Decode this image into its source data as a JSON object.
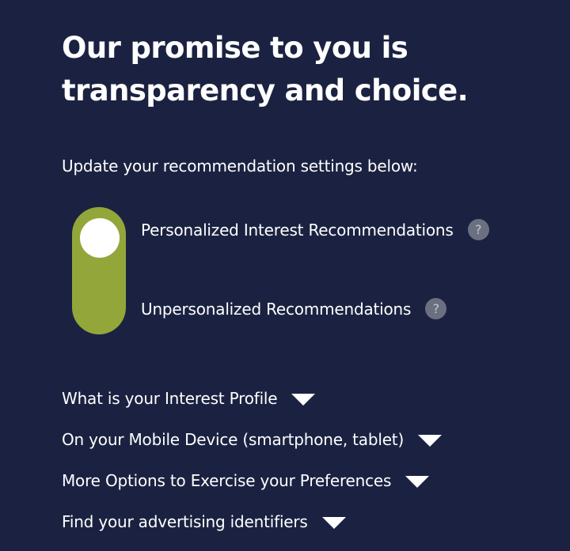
{
  "headline": "Our promise to you is transparency and choice.",
  "intro": "Update your recommendation settings below:",
  "recommendation_toggle": {
    "state": "personalized",
    "color": "#93a63a",
    "options": [
      {
        "label": "Personalized Interest Recommendations",
        "help_icon": "?"
      },
      {
        "label": "Unpersonalized Recommendations",
        "help_icon": "?"
      }
    ]
  },
  "accordions": [
    {
      "label": "What is your Interest Profile",
      "icon": "caret-down-icon"
    },
    {
      "label": "On your Mobile Device (smartphone, tablet)",
      "icon": "caret-down-icon"
    },
    {
      "label": "More Options to Exercise your Preferences",
      "icon": "caret-down-icon"
    },
    {
      "label": "Find your advertising identifiers",
      "icon": "caret-down-icon"
    }
  ],
  "colors": {
    "background": "#1b2241",
    "text": "#ffffff",
    "toggle_active": "#93a63a",
    "help_icon": "#6b7080"
  }
}
